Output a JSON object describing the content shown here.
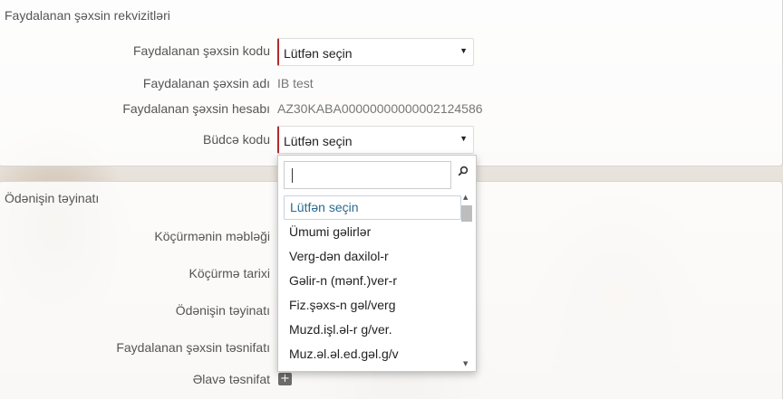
{
  "section1": {
    "title": "Faydalanan şəxsin rekvizitləri",
    "fields": {
      "code_label": "Faydalanan şəxsin kodu",
      "code_value": "Lütfən seçin",
      "name_label": "Faydalanan şəxsin adı",
      "name_value": "IB test",
      "account_label": "Faydalanan şəxsin hesabı",
      "account_value": "AZ30KABA00000000000002124586",
      "budget_label": "Büdcə kodu",
      "budget_value": "Lütfən seçin"
    }
  },
  "section2": {
    "title": "Ödənişin təyinatı",
    "fields": {
      "amount_label": "Köçürmənin məbləği",
      "date_label": "Köçürmə tarixi",
      "purpose_label": "Ödənişin təyinatı",
      "classification_label": "Faydalanan şəxsin təsnifatı",
      "extra_label": "Əlavə təsnifat"
    }
  },
  "dropdown": {
    "search_value": "",
    "items": [
      "Lütfən seçin",
      "Ümumi gəlirlər",
      "Verg-dən daxilol-r",
      "Gəlir-n (mənf.)ver-r",
      "Fiz.şəxs-n gəl/verg",
      "Muzd.işl.əl-r g/ver.",
      "Muz.əl.əl.ed.gəl.g/v"
    ],
    "selected_index": 0
  },
  "icons": {
    "caret": "caret-down-icon",
    "search": "search-icon",
    "add": "plus-icon"
  },
  "colors": {
    "required_border": "#b52a2a",
    "selected_item_text": "#2a6a8e"
  }
}
